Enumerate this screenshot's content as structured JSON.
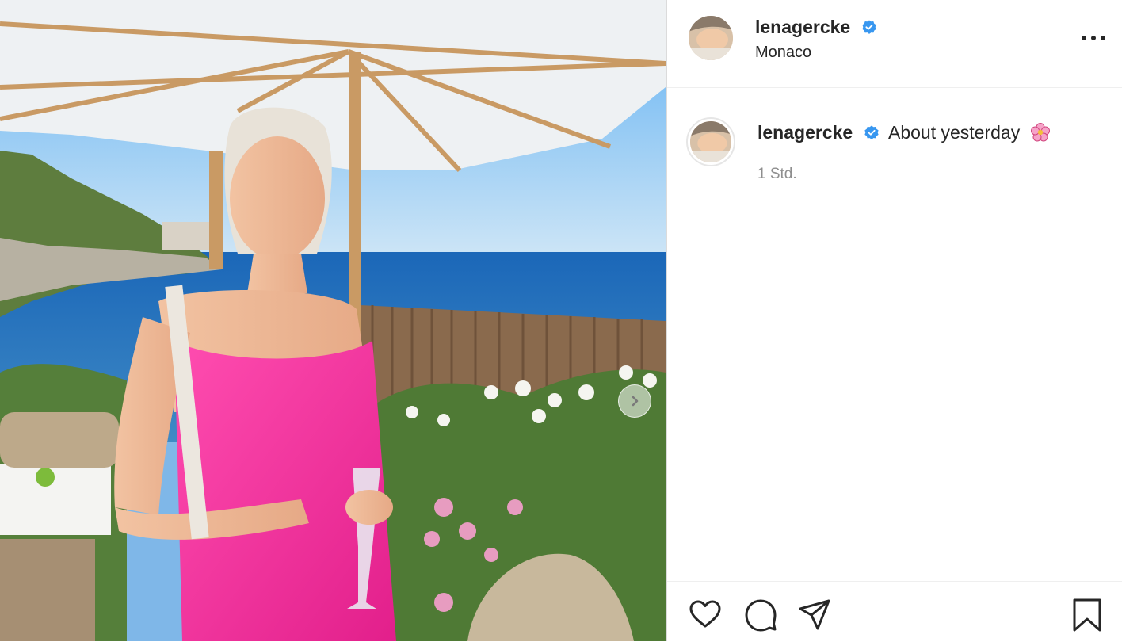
{
  "post": {
    "username": "lenagercke",
    "verified": true,
    "location": "Monaco",
    "caption": "About yesterday",
    "caption_emoji": "cherry-blossom",
    "time": "1 Std."
  },
  "icons": {
    "more": "more-options-icon",
    "like": "heart-icon",
    "comment": "comment-icon",
    "share": "send-icon",
    "save": "bookmark-icon",
    "next": "chevron-right-icon"
  },
  "colors": {
    "verified_blue": "#3897f0",
    "dress_pink": "#ef2f98",
    "text": "#262626",
    "muted": "#8e8e8e"
  }
}
